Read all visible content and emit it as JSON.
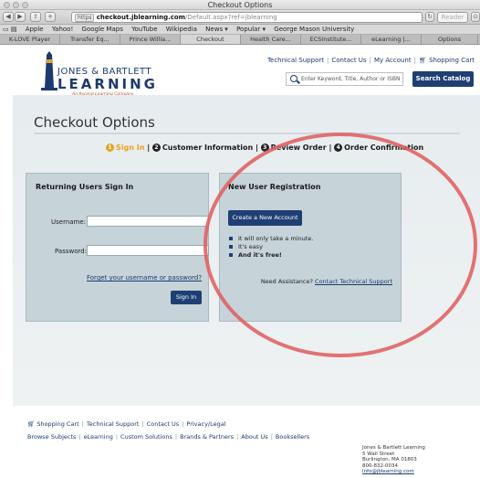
{
  "browser": {
    "window_title": "Checkout Options",
    "url_https": "https",
    "url_domain": "checkout.jblearning.com",
    "url_path": "/Default.aspx?ref=jblearning",
    "reader_label": "Reader",
    "bookmarks": [
      "Apple",
      "Yahoo!",
      "Google Maps",
      "YouTube",
      "Wikipedia",
      "News ▾",
      "Popular ▾",
      "George Mason University"
    ],
    "tabs": [
      "K-LOVE Player",
      "Transfer Eq...",
      "Prince Willia...",
      "Checkout",
      "Health Care...",
      "ECSInstitute...",
      "eLearning |...",
      "Options"
    ]
  },
  "header": {
    "logo_line1": "JONES & BARTLETT",
    "logo_line2": "LEARNING",
    "logo_tagline": "An Ascend Learning Company",
    "links": [
      "Technical Support",
      "Contact Us",
      "My Account",
      "Shopping Cart"
    ],
    "search_placeholder": "Enter Keyword, Title, Author or ISBN",
    "search_button": "Search Catalog"
  },
  "main": {
    "title": "Checkout Options",
    "steps": [
      {
        "num": "1",
        "label": "Sign In",
        "active": true
      },
      {
        "num": "2",
        "label": "Customer Information",
        "active": false
      },
      {
        "num": "3",
        "label": "Review Order",
        "active": false
      },
      {
        "num": "4",
        "label": "Order Confirmation",
        "active": false
      }
    ],
    "returning": {
      "heading": "Returning Users Sign In",
      "username_label": "Username:",
      "password_label": "Password:",
      "username_value": "",
      "password_value": "",
      "forgot_link": "Forget your username or password?",
      "signin_button": "Sign In"
    },
    "new_user": {
      "heading": "New User Registration",
      "create_button": "Create a New Account",
      "bullets": [
        "It will only take a minute.",
        "It's easy",
        "And it's free!"
      ],
      "assist_text": "Need Assistance?",
      "assist_link": "Contact Technical Support"
    }
  },
  "footer": {
    "row1": [
      "Shopping Cart",
      "Technical Support",
      "Contact Us",
      "Privacy/Legal"
    ],
    "row2": [
      "Browse Subjects",
      "eLearning",
      "Custom Solutions",
      "Brands & Partners",
      "About Us",
      "Booksellers"
    ],
    "address": [
      "Jones & Bartlett Learning",
      "5 Wall Street",
      "Burlington, MA 01803",
      "800-832-0034",
      "info@jblearning.com"
    ]
  },
  "colors": {
    "brand_navy": "#1f3f74",
    "accent_orange": "#e8a420",
    "panel_bg": "#c6d3d9",
    "annotation_circle": "#e06060"
  }
}
